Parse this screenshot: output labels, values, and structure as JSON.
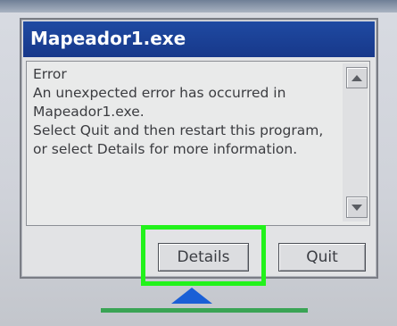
{
  "dialog": {
    "title": "Mapeador1.exe",
    "message": "Error\nAn unexpected error has occurred in Mapeador1.exe.\nSelect Quit and then restart this program, or select Details for more information.",
    "buttons": {
      "details_label": "Details",
      "quit_label": "Quit"
    }
  },
  "icons": {
    "scroll_up": "arrow-up-icon",
    "scroll_down": "arrow-down-icon",
    "sip": "keyboard-triangle-icon"
  },
  "colors": {
    "titlebar": "#1f4aa2",
    "highlight": "#22f21b",
    "taskbar_accent": "#3aa455",
    "sip_icon": "#1a5fd6"
  }
}
